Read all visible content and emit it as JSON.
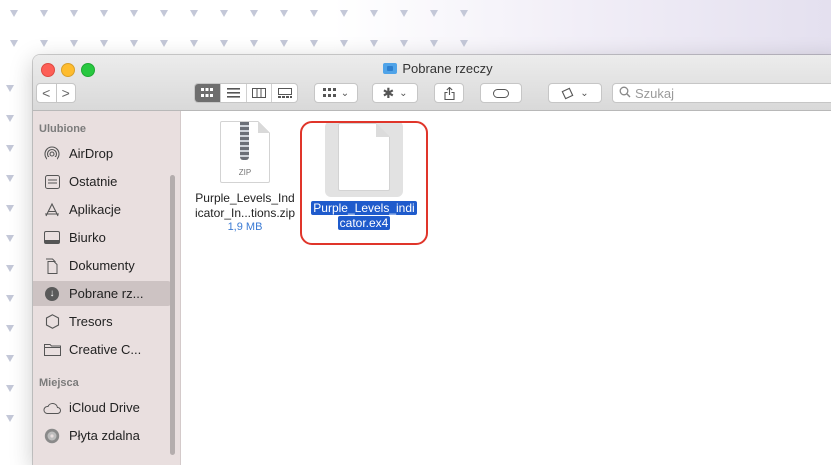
{
  "window": {
    "title": "Pobrane rzeczy"
  },
  "toolbar": {
    "back_glyph": "<",
    "forward_glyph": ">",
    "view_modes": [
      "icon-view",
      "list-view",
      "column-view",
      "gallery-view"
    ],
    "group_icon": "grid-icon",
    "action_icon": "gear-icon",
    "share_icon": "share-icon",
    "tag_icon": "tag-icon",
    "arrange_icon": "tag-outline-icon",
    "chevron": "⌄"
  },
  "search": {
    "placeholder": "Szukaj"
  },
  "sidebar": {
    "favorites_header": "Ulubione",
    "favorites": [
      {
        "label": "AirDrop",
        "icon": "airdrop-icon"
      },
      {
        "label": "Ostatnie",
        "icon": "recents-icon"
      },
      {
        "label": "Aplikacje",
        "icon": "applications-icon"
      },
      {
        "label": "Biurko",
        "icon": "desktop-icon"
      },
      {
        "label": "Dokumenty",
        "icon": "documents-icon"
      },
      {
        "label": "Pobrane rz...",
        "icon": "downloads-icon",
        "selected": true
      },
      {
        "label": "Tresors",
        "icon": "tresors-icon"
      },
      {
        "label": "Creative C...",
        "icon": "folder-icon"
      }
    ],
    "places_header": "Miejsca",
    "places": [
      {
        "label": "iCloud Drive",
        "icon": "cloud-icon"
      },
      {
        "label": "Płyta zdalna",
        "icon": "disc-icon"
      }
    ]
  },
  "files": [
    {
      "name_line1": "Purple_Levels_Ind",
      "name_line2": "icator_In...tions.zip",
      "size": "1,9 MB",
      "kind_label": "ZIP"
    },
    {
      "name_line1": "Purple_Levels_indi",
      "name_line2": "cator.ex4",
      "selected": true
    }
  ],
  "colors": {
    "selection": "#1f5bcc",
    "highlight_ring": "#e0352a",
    "sidebar_bg": "#e9dfdf"
  }
}
